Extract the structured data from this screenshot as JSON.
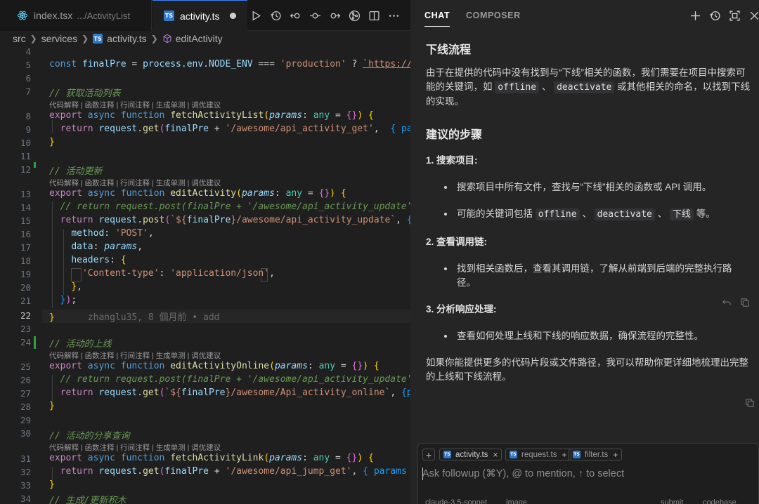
{
  "editor": {
    "tabs": [
      {
        "label": "index.tsx",
        "sublabel": ".../ActivityList",
        "icon": "react-icon"
      },
      {
        "label": "activity.ts",
        "icon": "typescript-file-icon",
        "dirty": true
      }
    ],
    "toolbar_icons": [
      "run-icon",
      "history-icon",
      "go-back-icon",
      "source-control-icon",
      "go-forward-icon",
      "git-merge-icon",
      "split-editor-icon",
      "more-icon"
    ],
    "breadcrumb": {
      "items": [
        "src",
        "services",
        "activity.ts",
        "editActivity"
      ]
    },
    "line_numbers": [
      "4",
      "5",
      "6",
      "7",
      "8",
      "9",
      "10",
      "11",
      "12",
      "13",
      "14",
      "15",
      "16",
      "17",
      "18",
      "19",
      "20",
      "21",
      "22",
      "23",
      "24",
      "25",
      "26",
      "27",
      "28",
      "29",
      "30",
      "31",
      "32",
      "33",
      "34"
    ],
    "active_line": "22",
    "codelens": [
      "代码解释",
      "函数注释",
      "行间注释",
      "生成单测",
      "调优建议"
    ],
    "blame": "zhanglu35, 8 個月前 • add",
    "code": {
      "l5": {
        "kw": "const",
        "var": "finalPre",
        "eq": " = ",
        "obj": "process",
        "env": ".env.",
        "node_env": "NODE_ENV",
        "op": " === ",
        "str": "'production'",
        "tern": " ? ",
        "tpl": "`https://a"
      },
      "c7": "// 获取活动列表",
      "c12": "// 活动更新",
      "c24": "// 活动的上线",
      "c30": "// 活动的分享查询",
      "c34": "// 生成/更新积木",
      "fn1": "fetchActivityList",
      "fn2": "editActivity",
      "fn3": "editActivityOnline",
      "fn4": "fetchActivityLink",
      "str_get1": "'/awesome/api_activity_get'",
      "param_frag": "{ par",
      "comment_post1": "// return request.post(finalPre + '/awesome/api_activity_update'",
      "comment_post1_tail": ",",
      "tpl_update": "/awesome/api_activity_update`",
      "method_key": "method",
      "method_val": "'POST'",
      "data_key": "data",
      "data_val": "params",
      "headers_key": "headers",
      "ct_key": "'Content-type'",
      "ct_val": "'application/json'",
      "comment_post2": "// return request.post(finalPre + '/awesome/api_activity_update',",
      "tpl_online": "/awesome/Api_activity_online`",
      "param_frag2": "{pa",
      "str_jump": "'/awesome/api_jump_get'",
      "param_frag3": "{ params }"
    }
  },
  "chat": {
    "tabs": [
      "CHAT",
      "COMPOSER"
    ],
    "header_icons": [
      "new-chat-icon",
      "history-icon",
      "maximize-icon",
      "close-icon"
    ],
    "heading1": "下线流程",
    "intro_a": "由于在提供的代码中没有找到与“下线”相关的函数，我们需要在项目中搜索可能的关键词，如",
    "intro_code1": "offline",
    "intro_b": "、",
    "intro_code2": "deactivate",
    "intro_c": "或其他相关的命名，以找到下线的实现。",
    "heading2": "建议的步骤",
    "step1": "1. 搜索项目:",
    "step1_b1": "搜索项目中所有文件，查找与“下线”相关的函数或 API 调用。",
    "step1_b2_a": "可能的关键词包括",
    "step1_b2_c1": "offline",
    "step1_b2_sep": "、",
    "step1_b2_c2": "deactivate",
    "step1_b2_c3": "下线",
    "step1_b2_end": "等。",
    "step2": "2. 查看调用链:",
    "step2_b1": "找到相关函数后，查看其调用链，了解从前端到后端的完整执行路径。",
    "step3": "3. 分析响应处理:",
    "step3_b1": "查看如何处理上线和下线的响应数据，确保流程的完整性。",
    "closing": "如果你能提供更多的代码片段或文件路径，我可以帮助你更详细地梳理出完整的上线和下线流程。",
    "composer": {
      "context_pills": [
        {
          "label": "activity.ts",
          "action": "×"
        },
        {
          "label": "request.ts",
          "action": "+"
        },
        {
          "label": "filter.ts",
          "action": "+"
        }
      ],
      "placeholder": "Ask followup (⌘Y), @ to mention, ↑ to select",
      "model": "claude-3.5-sonnet",
      "image_label": "image",
      "submit_label": "submit",
      "codebase_label": "codebase"
    }
  }
}
